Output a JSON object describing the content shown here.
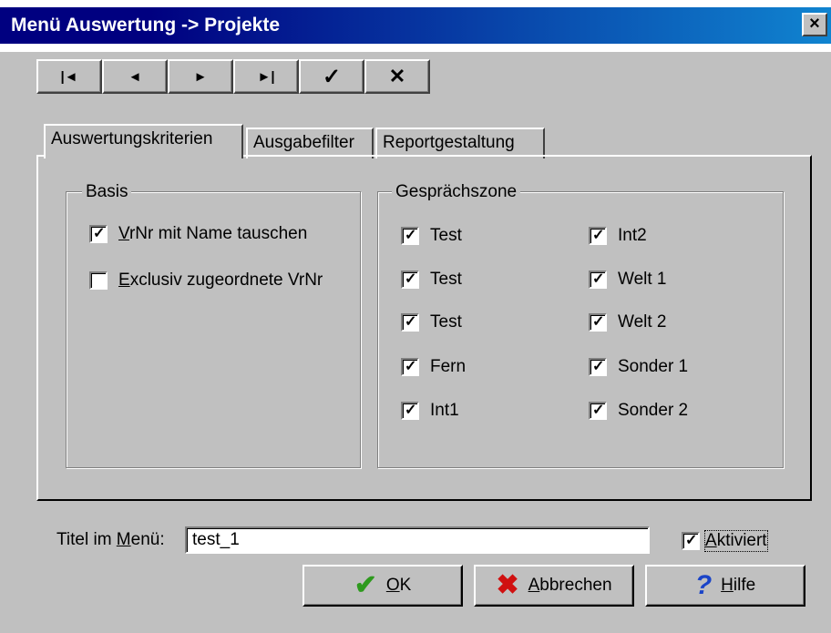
{
  "window": {
    "title": "Menü Auswertung -> Projekte",
    "close_glyph": "×"
  },
  "navigator": {
    "buttons": [
      {
        "name": "first-record-button",
        "icon": "first-icon",
        "glyph": "|◄"
      },
      {
        "name": "prior-record-button",
        "icon": "prior-icon",
        "glyph": "◄"
      },
      {
        "name": "next-record-button",
        "icon": "next-icon",
        "glyph": "►"
      },
      {
        "name": "last-record-button",
        "icon": "last-icon",
        "glyph": "►|"
      },
      {
        "name": "post-button",
        "icon": "check-icon",
        "glyph": "✓"
      },
      {
        "name": "cancel-edit-button",
        "icon": "cross-icon",
        "glyph": "✕"
      }
    ]
  },
  "tabs": {
    "t1": "Auswertungskriterien",
    "t2": "Ausgabefilter",
    "t3": "Reportgestaltung",
    "active": "Auswertungskriterien"
  },
  "basis": {
    "legend": "Basis",
    "cb1": {
      "ul": "V",
      "rest": "rNr mit Name tauschen",
      "checked": true
    },
    "cb2": {
      "ul": "E",
      "rest": "xclusiv zugeordnete VrNr",
      "checked": false
    }
  },
  "zone": {
    "legend": "Gesprächszone",
    "left": [
      "Test",
      "Test",
      "Test",
      "Fern",
      "Int1"
    ],
    "right": [
      "Int2",
      "Welt 1",
      "Welt 2",
      "Sonder 1",
      "Sonder 2"
    ],
    "checked": true
  },
  "bottom": {
    "label_pre": "Titel im ",
    "label_ul": "M",
    "label_post": "enü:",
    "input_value": "test_1",
    "aktiviert": {
      "ul": "A",
      "rest": "ktiviert",
      "checked": true
    }
  },
  "buttons": {
    "ok": {
      "ul": "O",
      "rest": "K",
      "icon": "check-icon"
    },
    "cancel": {
      "ul": "A",
      "rest": "bbrechen",
      "icon": "cross-icon"
    },
    "help": {
      "ul": "H",
      "rest": "ilfe",
      "icon": "question-icon"
    }
  },
  "colors": {
    "face": "#c0c0c0",
    "title_start": "#000080",
    "title_end": "#1084d0",
    "ok_green": "#2e9a1e",
    "cancel_red": "#d01010",
    "help_blue": "#1a44c8"
  }
}
